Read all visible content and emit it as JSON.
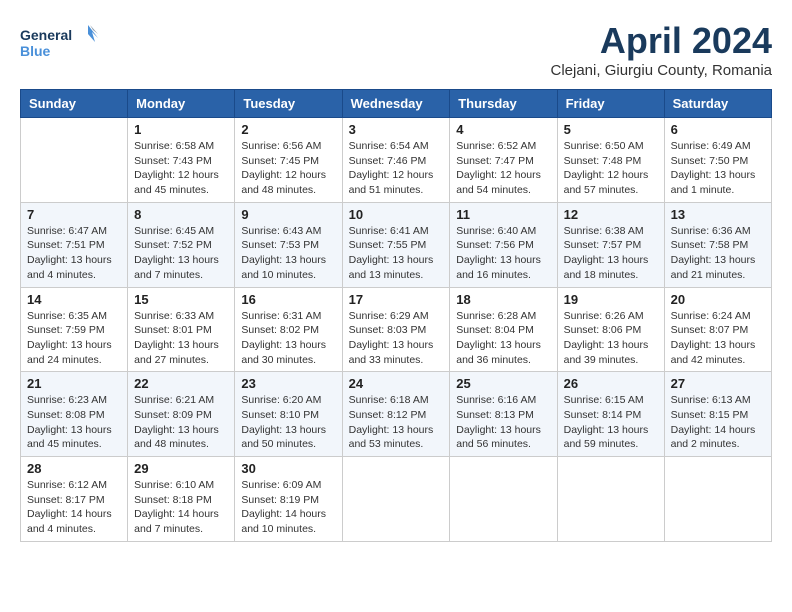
{
  "header": {
    "logo_line1": "General",
    "logo_line2": "Blue",
    "month_title": "April 2024",
    "subtitle": "Clejani, Giurgiu County, Romania"
  },
  "weekdays": [
    "Sunday",
    "Monday",
    "Tuesday",
    "Wednesday",
    "Thursday",
    "Friday",
    "Saturday"
  ],
  "weeks": [
    [
      {
        "day": "",
        "info": ""
      },
      {
        "day": "1",
        "info": "Sunrise: 6:58 AM\nSunset: 7:43 PM\nDaylight: 12 hours\nand 45 minutes."
      },
      {
        "day": "2",
        "info": "Sunrise: 6:56 AM\nSunset: 7:45 PM\nDaylight: 12 hours\nand 48 minutes."
      },
      {
        "day": "3",
        "info": "Sunrise: 6:54 AM\nSunset: 7:46 PM\nDaylight: 12 hours\nand 51 minutes."
      },
      {
        "day": "4",
        "info": "Sunrise: 6:52 AM\nSunset: 7:47 PM\nDaylight: 12 hours\nand 54 minutes."
      },
      {
        "day": "5",
        "info": "Sunrise: 6:50 AM\nSunset: 7:48 PM\nDaylight: 12 hours\nand 57 minutes."
      },
      {
        "day": "6",
        "info": "Sunrise: 6:49 AM\nSunset: 7:50 PM\nDaylight: 13 hours\nand 1 minute."
      }
    ],
    [
      {
        "day": "7",
        "info": "Sunrise: 6:47 AM\nSunset: 7:51 PM\nDaylight: 13 hours\nand 4 minutes."
      },
      {
        "day": "8",
        "info": "Sunrise: 6:45 AM\nSunset: 7:52 PM\nDaylight: 13 hours\nand 7 minutes."
      },
      {
        "day": "9",
        "info": "Sunrise: 6:43 AM\nSunset: 7:53 PM\nDaylight: 13 hours\nand 10 minutes."
      },
      {
        "day": "10",
        "info": "Sunrise: 6:41 AM\nSunset: 7:55 PM\nDaylight: 13 hours\nand 13 minutes."
      },
      {
        "day": "11",
        "info": "Sunrise: 6:40 AM\nSunset: 7:56 PM\nDaylight: 13 hours\nand 16 minutes."
      },
      {
        "day": "12",
        "info": "Sunrise: 6:38 AM\nSunset: 7:57 PM\nDaylight: 13 hours\nand 18 minutes."
      },
      {
        "day": "13",
        "info": "Sunrise: 6:36 AM\nSunset: 7:58 PM\nDaylight: 13 hours\nand 21 minutes."
      }
    ],
    [
      {
        "day": "14",
        "info": "Sunrise: 6:35 AM\nSunset: 7:59 PM\nDaylight: 13 hours\nand 24 minutes."
      },
      {
        "day": "15",
        "info": "Sunrise: 6:33 AM\nSunset: 8:01 PM\nDaylight: 13 hours\nand 27 minutes."
      },
      {
        "day": "16",
        "info": "Sunrise: 6:31 AM\nSunset: 8:02 PM\nDaylight: 13 hours\nand 30 minutes."
      },
      {
        "day": "17",
        "info": "Sunrise: 6:29 AM\nSunset: 8:03 PM\nDaylight: 13 hours\nand 33 minutes."
      },
      {
        "day": "18",
        "info": "Sunrise: 6:28 AM\nSunset: 8:04 PM\nDaylight: 13 hours\nand 36 minutes."
      },
      {
        "day": "19",
        "info": "Sunrise: 6:26 AM\nSunset: 8:06 PM\nDaylight: 13 hours\nand 39 minutes."
      },
      {
        "day": "20",
        "info": "Sunrise: 6:24 AM\nSunset: 8:07 PM\nDaylight: 13 hours\nand 42 minutes."
      }
    ],
    [
      {
        "day": "21",
        "info": "Sunrise: 6:23 AM\nSunset: 8:08 PM\nDaylight: 13 hours\nand 45 minutes."
      },
      {
        "day": "22",
        "info": "Sunrise: 6:21 AM\nSunset: 8:09 PM\nDaylight: 13 hours\nand 48 minutes."
      },
      {
        "day": "23",
        "info": "Sunrise: 6:20 AM\nSunset: 8:10 PM\nDaylight: 13 hours\nand 50 minutes."
      },
      {
        "day": "24",
        "info": "Sunrise: 6:18 AM\nSunset: 8:12 PM\nDaylight: 13 hours\nand 53 minutes."
      },
      {
        "day": "25",
        "info": "Sunrise: 6:16 AM\nSunset: 8:13 PM\nDaylight: 13 hours\nand 56 minutes."
      },
      {
        "day": "26",
        "info": "Sunrise: 6:15 AM\nSunset: 8:14 PM\nDaylight: 13 hours\nand 59 minutes."
      },
      {
        "day": "27",
        "info": "Sunrise: 6:13 AM\nSunset: 8:15 PM\nDaylight: 14 hours\nand 2 minutes."
      }
    ],
    [
      {
        "day": "28",
        "info": "Sunrise: 6:12 AM\nSunset: 8:17 PM\nDaylight: 14 hours\nand 4 minutes."
      },
      {
        "day": "29",
        "info": "Sunrise: 6:10 AM\nSunset: 8:18 PM\nDaylight: 14 hours\nand 7 minutes."
      },
      {
        "day": "30",
        "info": "Sunrise: 6:09 AM\nSunset: 8:19 PM\nDaylight: 14 hours\nand 10 minutes."
      },
      {
        "day": "",
        "info": ""
      },
      {
        "day": "",
        "info": ""
      },
      {
        "day": "",
        "info": ""
      },
      {
        "day": "",
        "info": ""
      }
    ]
  ]
}
